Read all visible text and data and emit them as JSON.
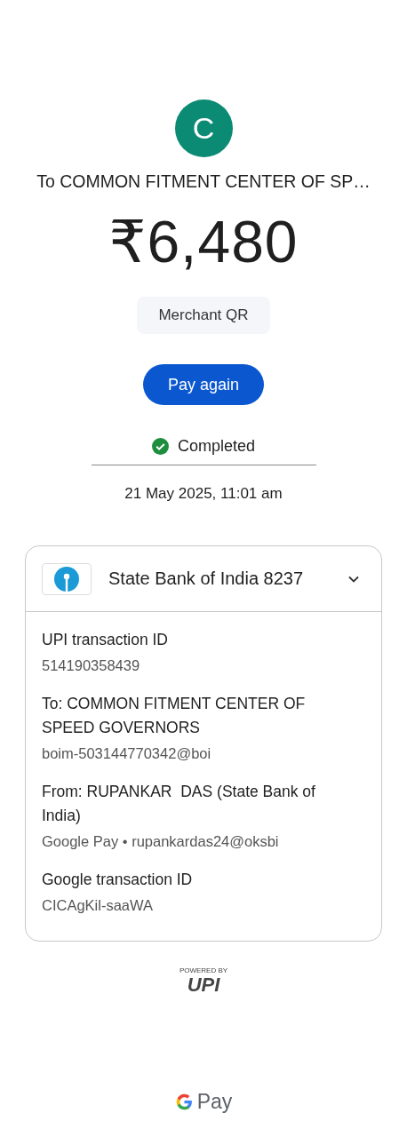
{
  "payee": {
    "initial": "C",
    "title": "To COMMON FITMENT CENTER OF SP…"
  },
  "amount": "₹6,480",
  "chip": "Merchant QR",
  "button": "Pay again",
  "status": {
    "kind": "completed",
    "label": "Completed"
  },
  "date": "21 May 2025, 11:01 am",
  "card": {
    "bank": "State Bank of India 8237",
    "expanded": true,
    "details": [
      {
        "label": "UPI transaction ID",
        "value": "514190358439"
      },
      {
        "label": "To: COMMON FITMENT CENTER OF SPEED GOVERNORS",
        "value": "boim-503144770342@boi"
      },
      {
        "label": "From: RUPANKAR  DAS (State Bank of India)",
        "value": "Google Pay • rupankardas24@oksbi"
      },
      {
        "label": "Google transaction ID",
        "value": "CICAgKil-saaWA"
      }
    ]
  },
  "powered": {
    "caption": "POWERED BY",
    "logo": "UPI"
  },
  "footer": {
    "brand": "Pay"
  }
}
